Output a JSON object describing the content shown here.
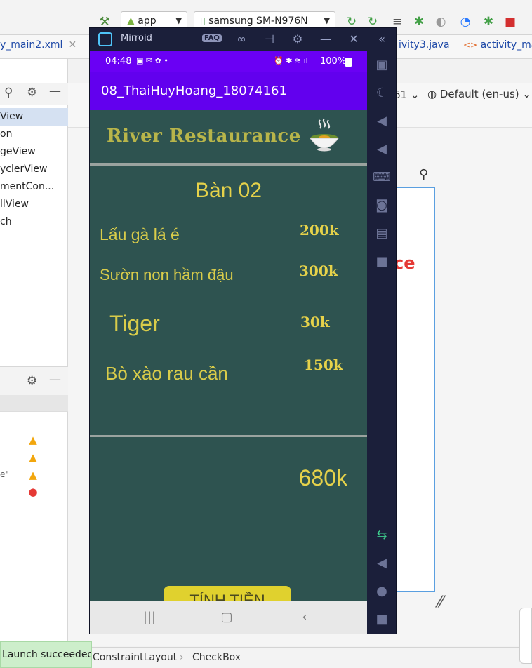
{
  "ide": {
    "run_config": "app",
    "device": "samsung SM-N976N",
    "tabs": [
      "y_main2.xml",
      "ivity3.java",
      "activity_ma"
    ],
    "palette_items": [
      "View",
      "on",
      "geView",
      "yclerView",
      "mentCon...",
      "llView",
      "ch"
    ],
    "design_api": "61",
    "locale": "Default (en-us)",
    "status_toast": "Launch succeeded",
    "breadcrumb": [
      "ConstraintLayout",
      "CheckBox"
    ],
    "side_quote": "e\"",
    "blueprint_text": "ce"
  },
  "mirroid": {
    "title": "Mirroid",
    "faq": "FAQ"
  },
  "phone": {
    "time": "04:48",
    "battery": "100%",
    "app_title": "08_ThaiHuyHoang_18074161",
    "brand": "River Restaurance",
    "table_label": "Bàn 02",
    "items": [
      {
        "name": "Lẩu gà lá é",
        "price": "200k"
      },
      {
        "name": "Sườn non hầm đậu",
        "price": "300k"
      },
      {
        "name": "Tiger",
        "price": "30k"
      },
      {
        "name": "Bò xào rau cần",
        "price": "150k"
      }
    ],
    "total": "680k",
    "pay_button": "TÍNH TIỀN"
  }
}
